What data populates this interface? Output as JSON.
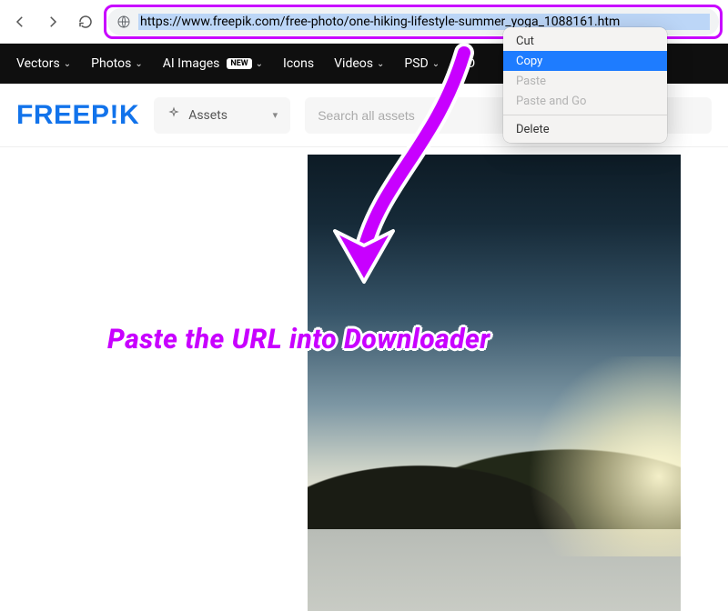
{
  "browser": {
    "url": "https://www.freepik.com/free-photo/one-hiking-lifestyle-summer_yoga_1088161.htm"
  },
  "context_menu": {
    "cut": "Cut",
    "copy": "Copy",
    "paste": "Paste",
    "paste_go": "Paste and Go",
    "delete": "Delete"
  },
  "nav": {
    "vectors": "Vectors",
    "photos": "Photos",
    "ai_images": "AI Images",
    "new_badge": "NEW",
    "icons": "Icons",
    "videos": "Videos",
    "psd": "PSD",
    "three_d": "3D"
  },
  "header": {
    "logo": "FREEP!K",
    "assets_label": "Assets",
    "search_placeholder": "Search all assets"
  },
  "annotation": {
    "instruction": "Paste the URL into Downloader"
  },
  "colors": {
    "highlight": "#c800ff",
    "menu_selected": "#1e7cff",
    "brand": "#1273eb"
  }
}
